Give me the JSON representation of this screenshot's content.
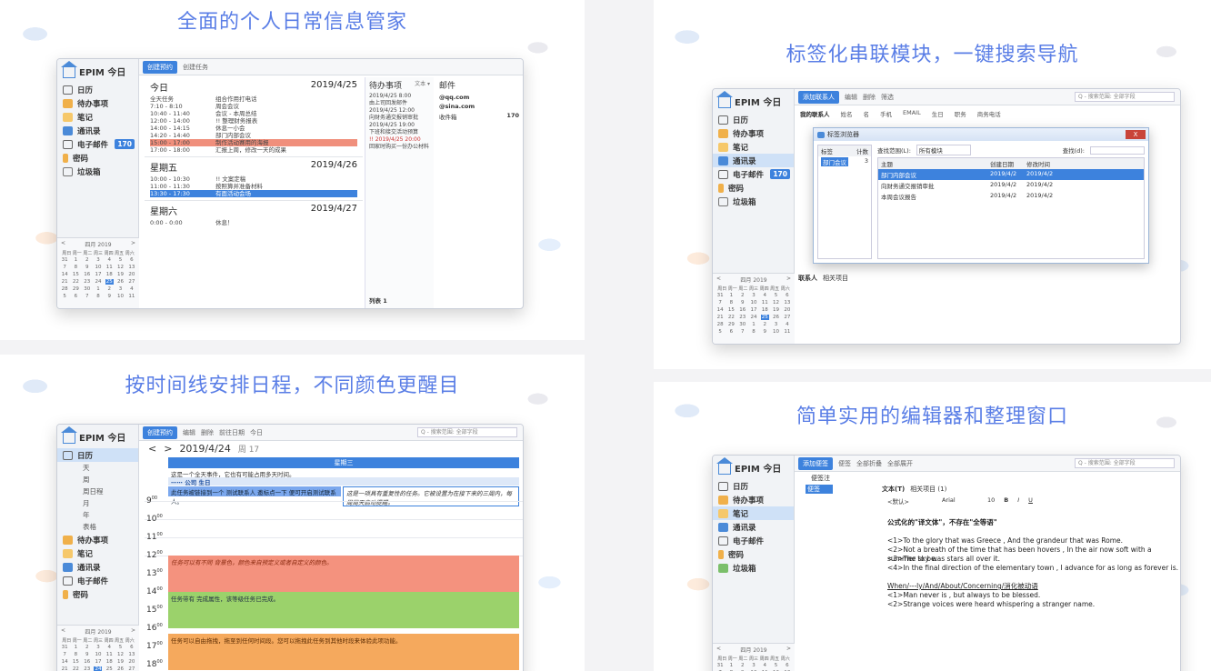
{
  "panels": {
    "p1_title": "全面的个人日常信息管家",
    "p2_title": "标签化串联模块，一键搜索导航",
    "p3_title": "按时间线安排日程，不同颜色更醒目",
    "p4_title": "简单实用的编辑器和整理窗口"
  },
  "sidebar": {
    "app_title": "EPIM 今日",
    "items": [
      "日历",
      "待办事项",
      "笔记",
      "通讯录",
      "电子邮件",
      "密码",
      "垃圾箱"
    ],
    "mail_count": "170",
    "calendar_sub": [
      "天",
      "周",
      "周日程",
      "月",
      "年",
      "表格"
    ]
  },
  "minical": {
    "month": "四月 2019",
    "weekhead": "周日 周一 周二 周三 周四 周五 周六",
    "rows": [
      [
        "31",
        "1",
        "2",
        "3",
        "4",
        "5",
        "6"
      ],
      [
        "7",
        "8",
        "9",
        "10",
        "11",
        "12",
        "13"
      ],
      [
        "14",
        "15",
        "16",
        "17",
        "18",
        "19",
        "20"
      ],
      [
        "21",
        "22",
        "23",
        "24",
        "25",
        "26",
        "27"
      ],
      [
        "28",
        "29",
        "30",
        "1",
        "2",
        "3",
        "4"
      ],
      [
        "5",
        "6",
        "7",
        "8",
        "9",
        "10",
        "11"
      ]
    ],
    "nav_prev": "<",
    "nav_next": ">"
  },
  "p1": {
    "toolbar": [
      "创建预约",
      "创建任务"
    ],
    "today_label": "今日",
    "today_date": "2019/4/25",
    "today_events": [
      {
        "t": "全天任务",
        "d": "组合作用打电话",
        "c": ""
      },
      {
        "t": "7:10 - 8:10",
        "d": "周会会议",
        "c": ""
      },
      {
        "t": "10:40 - 11:40",
        "d": "会议 - 本周总结",
        "c": ""
      },
      {
        "t": "12:00 - 14:00",
        "d": "!! 整理财务报表",
        "c": ""
      },
      {
        "t": "14:00 - 14:15",
        "d": "休息一小会",
        "c": ""
      },
      {
        "t": "14:20 - 14:40",
        "d": "部门内部会议",
        "c": ""
      },
      {
        "t": "15:00 - 17:00",
        "d": "制作活动赛用的海报",
        "c": "red"
      },
      {
        "t": "17:00 - 18:00",
        "d": "汇报上周，修改一天的成果",
        "c": ""
      }
    ],
    "fri_label": "星期五",
    "fri_date": "2019/4/26",
    "fri_events": [
      {
        "t": "10:00 - 10:30",
        "d": "!! 文案定稿",
        "c": ""
      },
      {
        "t": "11:00 - 11:30",
        "d": "按照算并准备材料",
        "c": ""
      },
      {
        "t": "13:30 - 17:30",
        "d": "有面活动会场",
        "c": "blue"
      }
    ],
    "sat_label": "星期六",
    "sat_date": "2019/4/27",
    "sat_events": [
      {
        "t": "0:00 - 0:00",
        "d": "休息！",
        "c": ""
      }
    ],
    "todo_title": "待办事项",
    "todo_sort": "文本 ▾",
    "todos": [
      "2019/4/25 8:00",
      "由上司回发邮件",
      "2019/4/25 12:00",
      "向财务通交报销审批",
      "2019/4/25 19:00",
      "下班和接交活动预算",
      "!! 2019/4/25 20:00",
      "回家时购买一份办公材料"
    ],
    "todo_footer": "列表 1",
    "mail_title": "邮件",
    "mails": [
      {
        "a": "@qq.com",
        "b": ""
      },
      {
        "a": "@sina.com",
        "b": ""
      },
      {
        "a": "收件箱",
        "b": "170"
      }
    ]
  },
  "p2": {
    "toolbar": [
      "添加联系人",
      "编辑",
      "删除",
      "筛选"
    ],
    "search": "Q - 搜索范围: 全部字段",
    "list_title": "我的联系人",
    "cols": [
      "姓名",
      "名",
      "手机",
      "EMAIL",
      "生日",
      "职务",
      "商务电话"
    ],
    "dialog_title": "标签浏览器",
    "dlg_close": "X",
    "tag_head": [
      "标签",
      "计数"
    ],
    "tag_row": [
      "部门会议",
      "3"
    ],
    "scope_label": "查找范围(L):",
    "scope_val": "所有模块",
    "find_label": "查找(d):",
    "res_head": [
      "主题",
      "创建日期",
      "修改时间"
    ],
    "results": [
      [
        "部门内部会议",
        "2019/4/2",
        "2019/4/2"
      ],
      [
        "向财务通交报销审批",
        "2019/4/2",
        "2019/4/2"
      ],
      [
        "本周会议报告",
        "2019/4/2",
        "2019/4/2"
      ]
    ],
    "bottom_tabs": [
      "联系人",
      "相关项目"
    ]
  },
  "p3": {
    "toolbar": [
      "创建预约",
      "编辑",
      "删除",
      "前往日期",
      "今日"
    ],
    "search": "Q - 搜索范围: 全部字段",
    "date": "2019/4/24",
    "week": "周 17",
    "day_head": "星期三",
    "allday1": "这是一个全天事件，它也有可能占用多天时间。",
    "allday2": "⋯⋯ 公司 生日",
    "event1": "此任务被链接到一个 测试联系人 邀标点一下 便可开启测试联系人。",
    "event2": "这是一项具有重复性的任务。它被设置为在接下来的三周内，每周周天启动提醒。",
    "hours": [
      "9",
      "10",
      "11",
      "12",
      "13",
      "14",
      "15",
      "16",
      "17",
      "18"
    ],
    "blk_red": "任务可以有不同 背景色，颜色来自预定义或者自定义的颜色。",
    "blk_green": "任务带有 完成属性，该等级任务已完成。",
    "blk_orange": "任务可以自由拖拽，拖至到任何时间段。您可以拖拽此任务到其他时段来体验此项功能。"
  },
  "p4": {
    "toolbar": [
      "添加便签",
      "便签",
      "全部折叠",
      "全部展开"
    ],
    "search": "Q - 搜索范围: 全部字段",
    "tree_root": "便签",
    "tree_item": "便签",
    "tree_col": "便签注",
    "tabs": [
      "文本(T)",
      "相关项目 (1)"
    ],
    "font": "<默认>",
    "font2": "Arial",
    "size": "10",
    "lines": [
      "公式化的\"译文体\"，不存在\"全等语\"",
      "",
      "<1>To the glory that was Greece , And the grandeur that was Rome.",
      "<2>Not a breath of the time that has been hovers , In the air now soft with a summer to be.",
      "<3>The sky was stars all over it.",
      "<4>In the final direction of the elementary town , I advance for as long as forever is.",
      "",
      "When/---ly/And/About/Concerning/消化被动语",
      "<1>Man never is , but always to be blessed.",
      "<2>Strange voices were heard whispering a stranger name."
    ]
  },
  "colors": {
    "accent": "#3d82dd",
    "title": "#5a7ee6",
    "red": "#f08f7c",
    "green": "#9bd26b",
    "orange": "#f5a95d"
  }
}
